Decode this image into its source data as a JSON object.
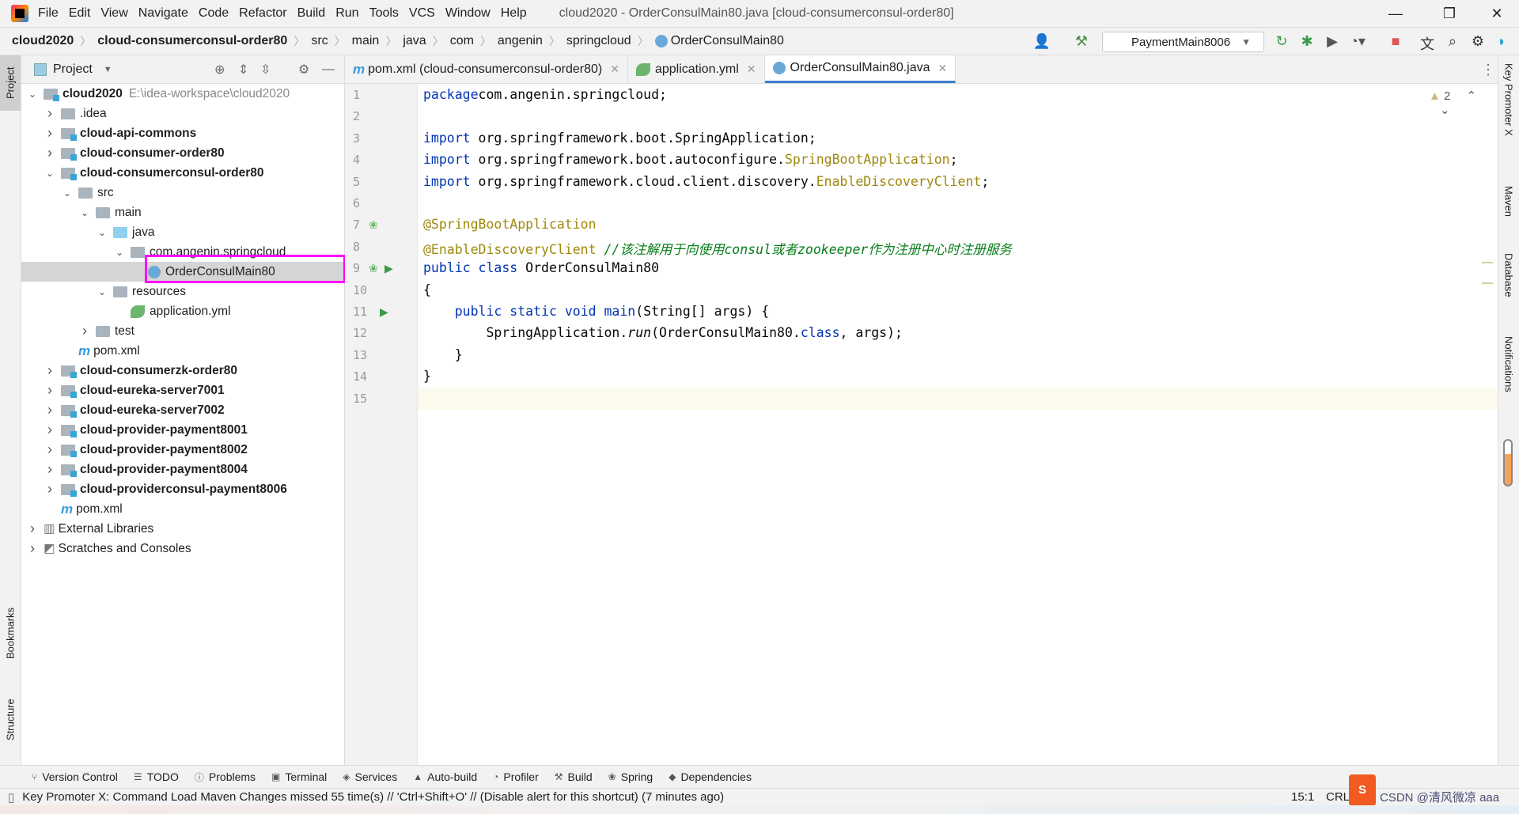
{
  "menu": [
    "File",
    "Edit",
    "View",
    "Navigate",
    "Code",
    "Refactor",
    "Build",
    "Run",
    "Tools",
    "VCS",
    "Window",
    "Help"
  ],
  "window_title": "cloud2020 - OrderConsulMain80.java [cloud-consumerconsul-order80]",
  "breadcrumb": [
    "cloud2020",
    "cloud-consumerconsul-order80",
    "src",
    "main",
    "java",
    "com",
    "angenin",
    "springcloud",
    "OrderConsulMain80"
  ],
  "run_config": "PaymentMain8006",
  "project_panel": {
    "title": "Project"
  },
  "tree": [
    {
      "label": "cloud2020",
      "extra": "E:\\idea-workspace\\cloud2020",
      "depth": 0,
      "arrow": "down",
      "icon": "module",
      "bold": true
    },
    {
      "label": ".idea",
      "depth": 1,
      "arrow": "right",
      "icon": "folder"
    },
    {
      "label": "cloud-api-commons",
      "depth": 1,
      "arrow": "right",
      "icon": "module",
      "bold": true
    },
    {
      "label": "cloud-consumer-order80",
      "depth": 1,
      "arrow": "right",
      "icon": "module",
      "bold": true
    },
    {
      "label": "cloud-consumerconsul-order80",
      "depth": 1,
      "arrow": "down",
      "icon": "module",
      "bold": true
    },
    {
      "label": "src",
      "depth": 2,
      "arrow": "down",
      "icon": "folder"
    },
    {
      "label": "main",
      "depth": 3,
      "arrow": "down",
      "icon": "folder"
    },
    {
      "label": "java",
      "depth": 4,
      "arrow": "down",
      "icon": "src"
    },
    {
      "label": "com.angenin.springcloud",
      "depth": 5,
      "arrow": "down",
      "icon": "folder"
    },
    {
      "label": "OrderConsulMain80",
      "depth": 6,
      "arrow": "",
      "icon": "class",
      "selected": true
    },
    {
      "label": "resources",
      "depth": 4,
      "arrow": "down",
      "icon": "folder"
    },
    {
      "label": "application.yml",
      "depth": 5,
      "arrow": "",
      "icon": "yml"
    },
    {
      "label": "test",
      "depth": 3,
      "arrow": "right",
      "icon": "folder"
    },
    {
      "label": "pom.xml",
      "depth": 2,
      "arrow": "",
      "icon": "maven"
    },
    {
      "label": "cloud-consumerzk-order80",
      "depth": 1,
      "arrow": "right",
      "icon": "module",
      "bold": true
    },
    {
      "label": "cloud-eureka-server7001",
      "depth": 1,
      "arrow": "right",
      "icon": "module",
      "bold": true
    },
    {
      "label": "cloud-eureka-server7002",
      "depth": 1,
      "arrow": "right",
      "icon": "module",
      "bold": true
    },
    {
      "label": "cloud-provider-payment8001",
      "depth": 1,
      "arrow": "right",
      "icon": "module",
      "bold": true
    },
    {
      "label": "cloud-provider-payment8002",
      "depth": 1,
      "arrow": "right",
      "icon": "module",
      "bold": true
    },
    {
      "label": "cloud-provider-payment8004",
      "depth": 1,
      "arrow": "right",
      "icon": "module",
      "bold": true
    },
    {
      "label": "cloud-providerconsul-payment8006",
      "depth": 1,
      "arrow": "right",
      "icon": "module",
      "bold": true
    },
    {
      "label": "pom.xml",
      "depth": 1,
      "arrow": "",
      "icon": "maven"
    },
    {
      "label": "External Libraries",
      "depth": 0,
      "arrow": "right",
      "icon": "lib"
    },
    {
      "label": "Scratches and Consoles",
      "depth": 0,
      "arrow": "right",
      "icon": "scratch"
    }
  ],
  "tabs": [
    {
      "label": "pom.xml (cloud-consumerconsul-order80)",
      "icon": "maven"
    },
    {
      "label": "application.yml",
      "icon": "yml"
    },
    {
      "label": "OrderConsulMain80.java",
      "icon": "class",
      "active": true
    }
  ],
  "code_lines": [
    [
      [
        "kw",
        "package"
      ],
      [
        "",
        "com.angenin.springcloud;"
      ]
    ],
    [],
    [
      [
        "kw",
        "import"
      ],
      [
        "",
        " org.springframework.boot.SpringApplication;"
      ]
    ],
    [
      [
        "kw",
        "import"
      ],
      [
        "",
        " org.springframework.boot.autoconfigure."
      ],
      [
        "ann",
        "SpringBootApplication"
      ],
      [
        "",
        ";"
      ]
    ],
    [
      [
        "kw",
        "import"
      ],
      [
        "",
        " org.springframework.cloud.client.discovery."
      ],
      [
        "ann",
        "EnableDiscoveryClient"
      ],
      [
        "",
        ";"
      ]
    ],
    [],
    [
      [
        "ann",
        "@SpringBootApplication"
      ]
    ],
    [
      [
        "ann",
        "@EnableDiscoveryClient"
      ],
      [
        "",
        " "
      ],
      [
        "cm",
        "//该注解用于向使用consul或者zookeeper作为注册中心时注册服务"
      ]
    ],
    [
      [
        "kw",
        "public class"
      ],
      [
        "",
        " OrderConsulMain80"
      ]
    ],
    [
      [
        "",
        "{"
      ]
    ],
    [
      [
        "",
        "    "
      ],
      [
        "kw",
        "public static void"
      ],
      [
        "",
        " "
      ],
      [
        "kw",
        "main"
      ],
      [
        "",
        "(String[] args) {"
      ]
    ],
    [
      [
        "",
        "        SpringApplication."
      ],
      [
        "it",
        "run"
      ],
      [
        "",
        "(OrderConsulMain80."
      ],
      [
        "kw",
        "class"
      ],
      [
        "",
        ", args);"
      ]
    ],
    [
      [
        "",
        "    }"
      ]
    ],
    [
      [
        "",
        "}"
      ]
    ],
    []
  ],
  "inspection": {
    "warnings": "2"
  },
  "left_stripe": [
    "Project",
    "Bookmarks",
    "Structure"
  ],
  "right_stripe": [
    "Key Promoter X",
    "Maven",
    "Database",
    "Notifications"
  ],
  "tool_windows": [
    "Version Control",
    "TODO",
    "Problems",
    "Terminal",
    "Services",
    "Auto-build",
    "Profiler",
    "Build",
    "Spring",
    "Dependencies"
  ],
  "status": {
    "message": "Key Promoter X: Command Load Maven Changes missed 55 time(s) // 'Ctrl+Shift+O' // (Disable alert for this shortcut) (7 minutes ago)",
    "position": "15:1",
    "line_sep": "CRLF",
    "watermark": "CSDN @清风微凉 aaa"
  },
  "colors": {
    "accent": "#3f7fcf",
    "selection": "#d5d5d5",
    "highlight_box": "#ff00ff",
    "keyword": "#0033b3",
    "annotation": "#9e880d",
    "comment": "#067d17"
  }
}
